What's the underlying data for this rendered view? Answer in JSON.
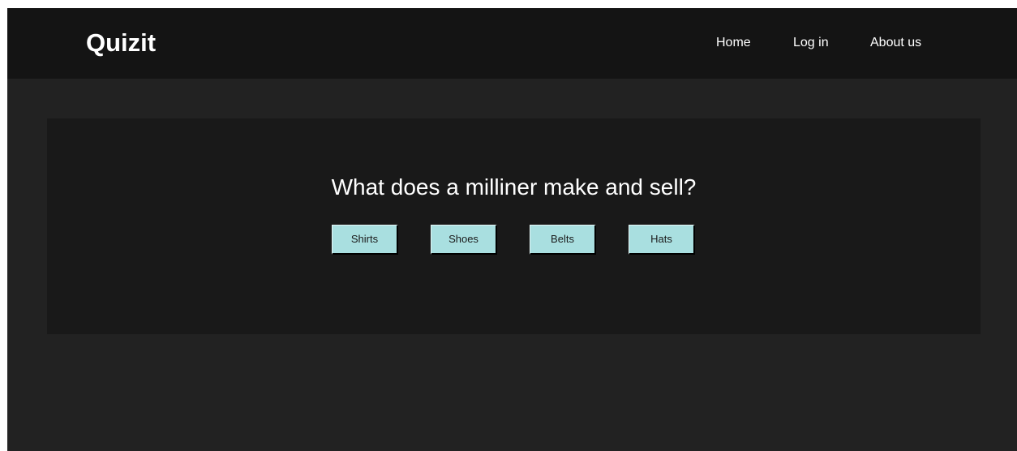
{
  "header": {
    "logo": "Quizit",
    "nav": {
      "home": "Home",
      "login": "Log in",
      "about": "About us"
    }
  },
  "quiz": {
    "question": "What does a milliner make and sell?",
    "answers": [
      "Shirts",
      "Shoes",
      "Belts",
      "Hats"
    ]
  },
  "colors": {
    "page_background": "#222222",
    "header_background": "#141414",
    "card_background": "#191919",
    "answer_button": "#a9dfe0"
  }
}
